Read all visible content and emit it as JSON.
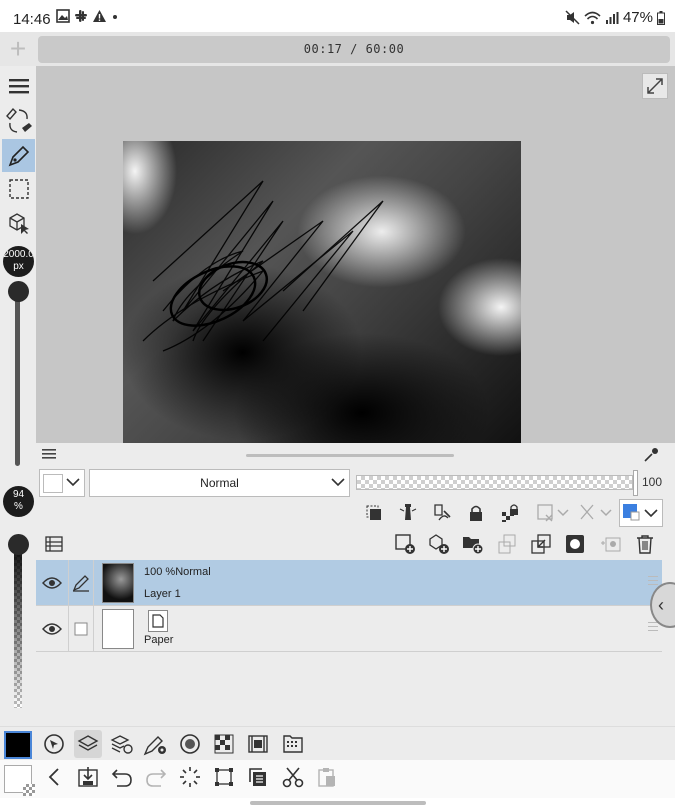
{
  "status_bar": {
    "time": "14:46",
    "battery": "47%",
    "notification_icons": [
      "gallery-icon",
      "slack-icon",
      "warning-icon",
      "dot-icon"
    ],
    "system_icons": [
      "mute-icon",
      "wifi-icon",
      "signal-icon",
      "battery-icon"
    ]
  },
  "timer": {
    "text": "00:17 / 60:00"
  },
  "tool_settings": {
    "brush_size": "2000.0",
    "brush_size_unit": "px",
    "opacity": "94",
    "opacity_unit": "%"
  },
  "layer_panel": {
    "blend_mode": "Normal",
    "opacity_value": "100",
    "layers": [
      {
        "opacity_mode": "100 %Normal",
        "name": "Layer 1",
        "selected": true,
        "visible": true
      },
      {
        "name": "Paper",
        "selected": false,
        "visible": true
      }
    ]
  },
  "colors": {
    "accent": "#4a86d8",
    "selection": "#b1cbe3",
    "main_color": "#000000",
    "sub_color": "#ffffff",
    "layer_color": "#3b7fe0"
  }
}
